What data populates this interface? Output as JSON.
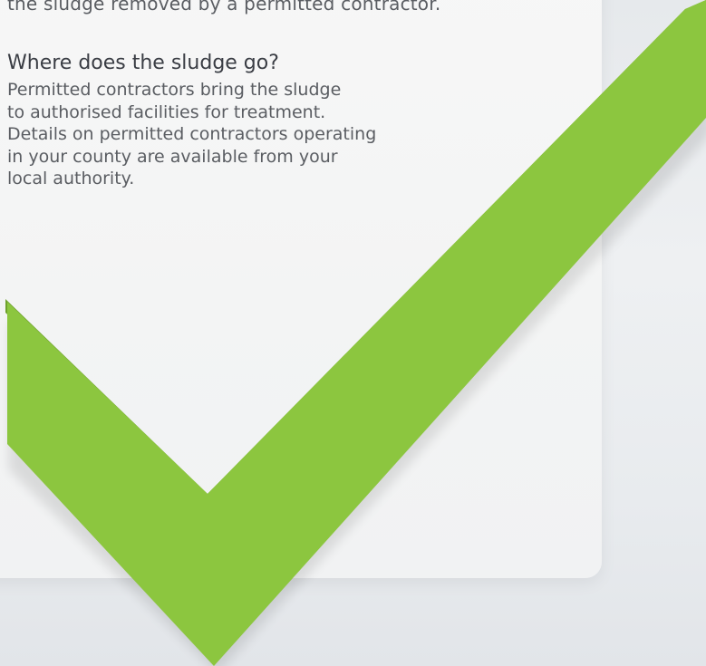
{
  "text": {
    "intro_tail": "the sludge removed by a permitted contractor.",
    "heading": "Where does the sludge go?",
    "body_lines": [
      "Permitted contractors bring the sludge",
      "to authorised facilities for treatment.",
      "Details on permitted contractors operating",
      "in your county are available from your",
      "local authority."
    ]
  },
  "colors": {
    "checkmark": "#8cc63f",
    "checkmark_shadow": "#6ea12c",
    "card": "#f5f5f5",
    "text": "#5a5d62",
    "heading": "#3a3d44"
  },
  "graphics": {
    "checkmark_icon": "checkmark-icon"
  }
}
